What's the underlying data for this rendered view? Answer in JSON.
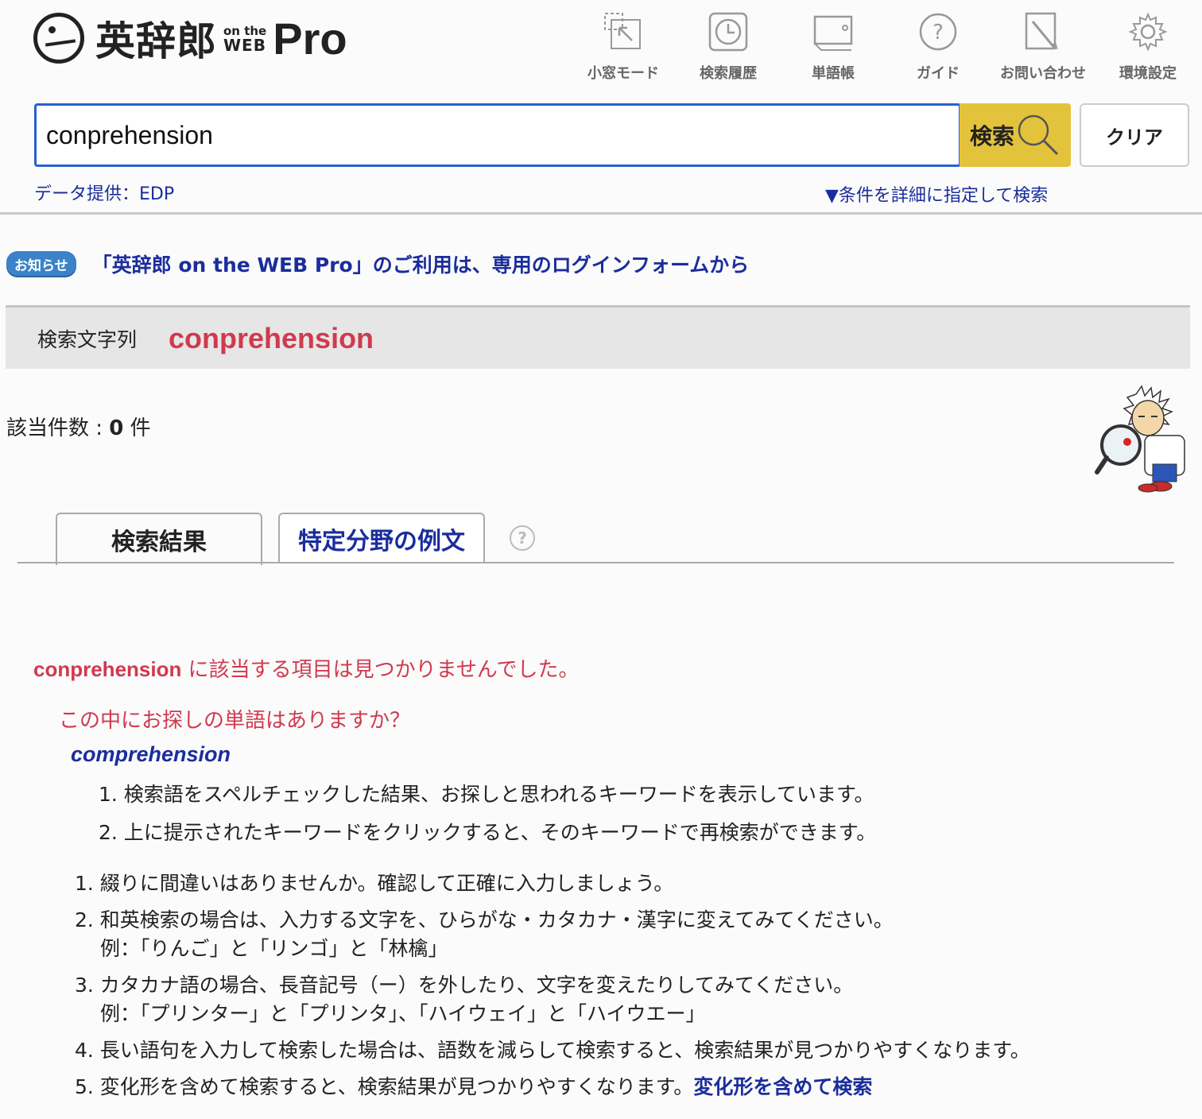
{
  "logo": {
    "main": "英辞郎",
    "on_the": "on the",
    "web": "WEB",
    "pro": "Pro"
  },
  "toolbar": [
    {
      "icon": "small-window-icon",
      "label": "小窓モード"
    },
    {
      "icon": "clock-icon",
      "label": "検索履歴"
    },
    {
      "icon": "wordbook-icon",
      "label": "単語帳"
    },
    {
      "icon": "question-icon",
      "label": "ガイド"
    },
    {
      "icon": "pencil-icon",
      "label": "お問い合わせ"
    },
    {
      "icon": "gear-icon",
      "label": "環境設定"
    }
  ],
  "search": {
    "value": "conprehension",
    "button_label": "検索",
    "clear_label": "クリア"
  },
  "data_credit": "データ提供：EDP",
  "advanced_link": "▼条件を詳細に指定して検索",
  "notice": {
    "badge": "お知らせ",
    "text": "「英辞郎 on the WEB Pro」のご利用は、専用のログインフォームから"
  },
  "query": {
    "label": "検索文字列",
    "term": "conprehension"
  },
  "count": {
    "label": "該当件数 : ",
    "value": "0",
    "unit": " 件"
  },
  "tabs": {
    "results": "検索結果",
    "field_examples": "特定分野の例文",
    "help": "?"
  },
  "results": {
    "notfound_term": "conprehension",
    "notfound_msg": " に該当する項目は見つかりませんでした。",
    "suggest_question": "この中にお探しの単語はありますか？",
    "suggestion": "comprehension",
    "sub_notes": [
      "1. 検索語をスペルチェックした結果、お探しと思われるキーワードを表示しています。",
      "2. 上に提示されたキーワードをクリックすると、そのキーワードで再検索ができます。"
    ],
    "tips": [
      {
        "text": "1. 綴りに間違いはありませんか。確認して正確に入力しましょう。",
        "example": ""
      },
      {
        "text": "2. 和英検索の場合は、入力する文字を、ひらがな・カタカナ・漢字に変えてみてください。",
        "example": "例：「りんご」と「リンゴ」と「林檎」"
      },
      {
        "text": "3. カタカナ語の場合、長音記号（ー）を外したり、文字を変えたりしてみてください。",
        "example": "例：「プリンター」と「プリンタ」、「ハイウェイ」と「ハイウエー」"
      },
      {
        "text": "4. 長い語句を入力して検索した場合は、語数を減らして検索すると、検索結果が見つかりやすくなります。",
        "example": ""
      },
      {
        "text": "5. 変化形を含めて検索すると、検索結果が見つかりやすくなります。",
        "example": "",
        "link": "変化形を含めて検索"
      }
    ]
  }
}
